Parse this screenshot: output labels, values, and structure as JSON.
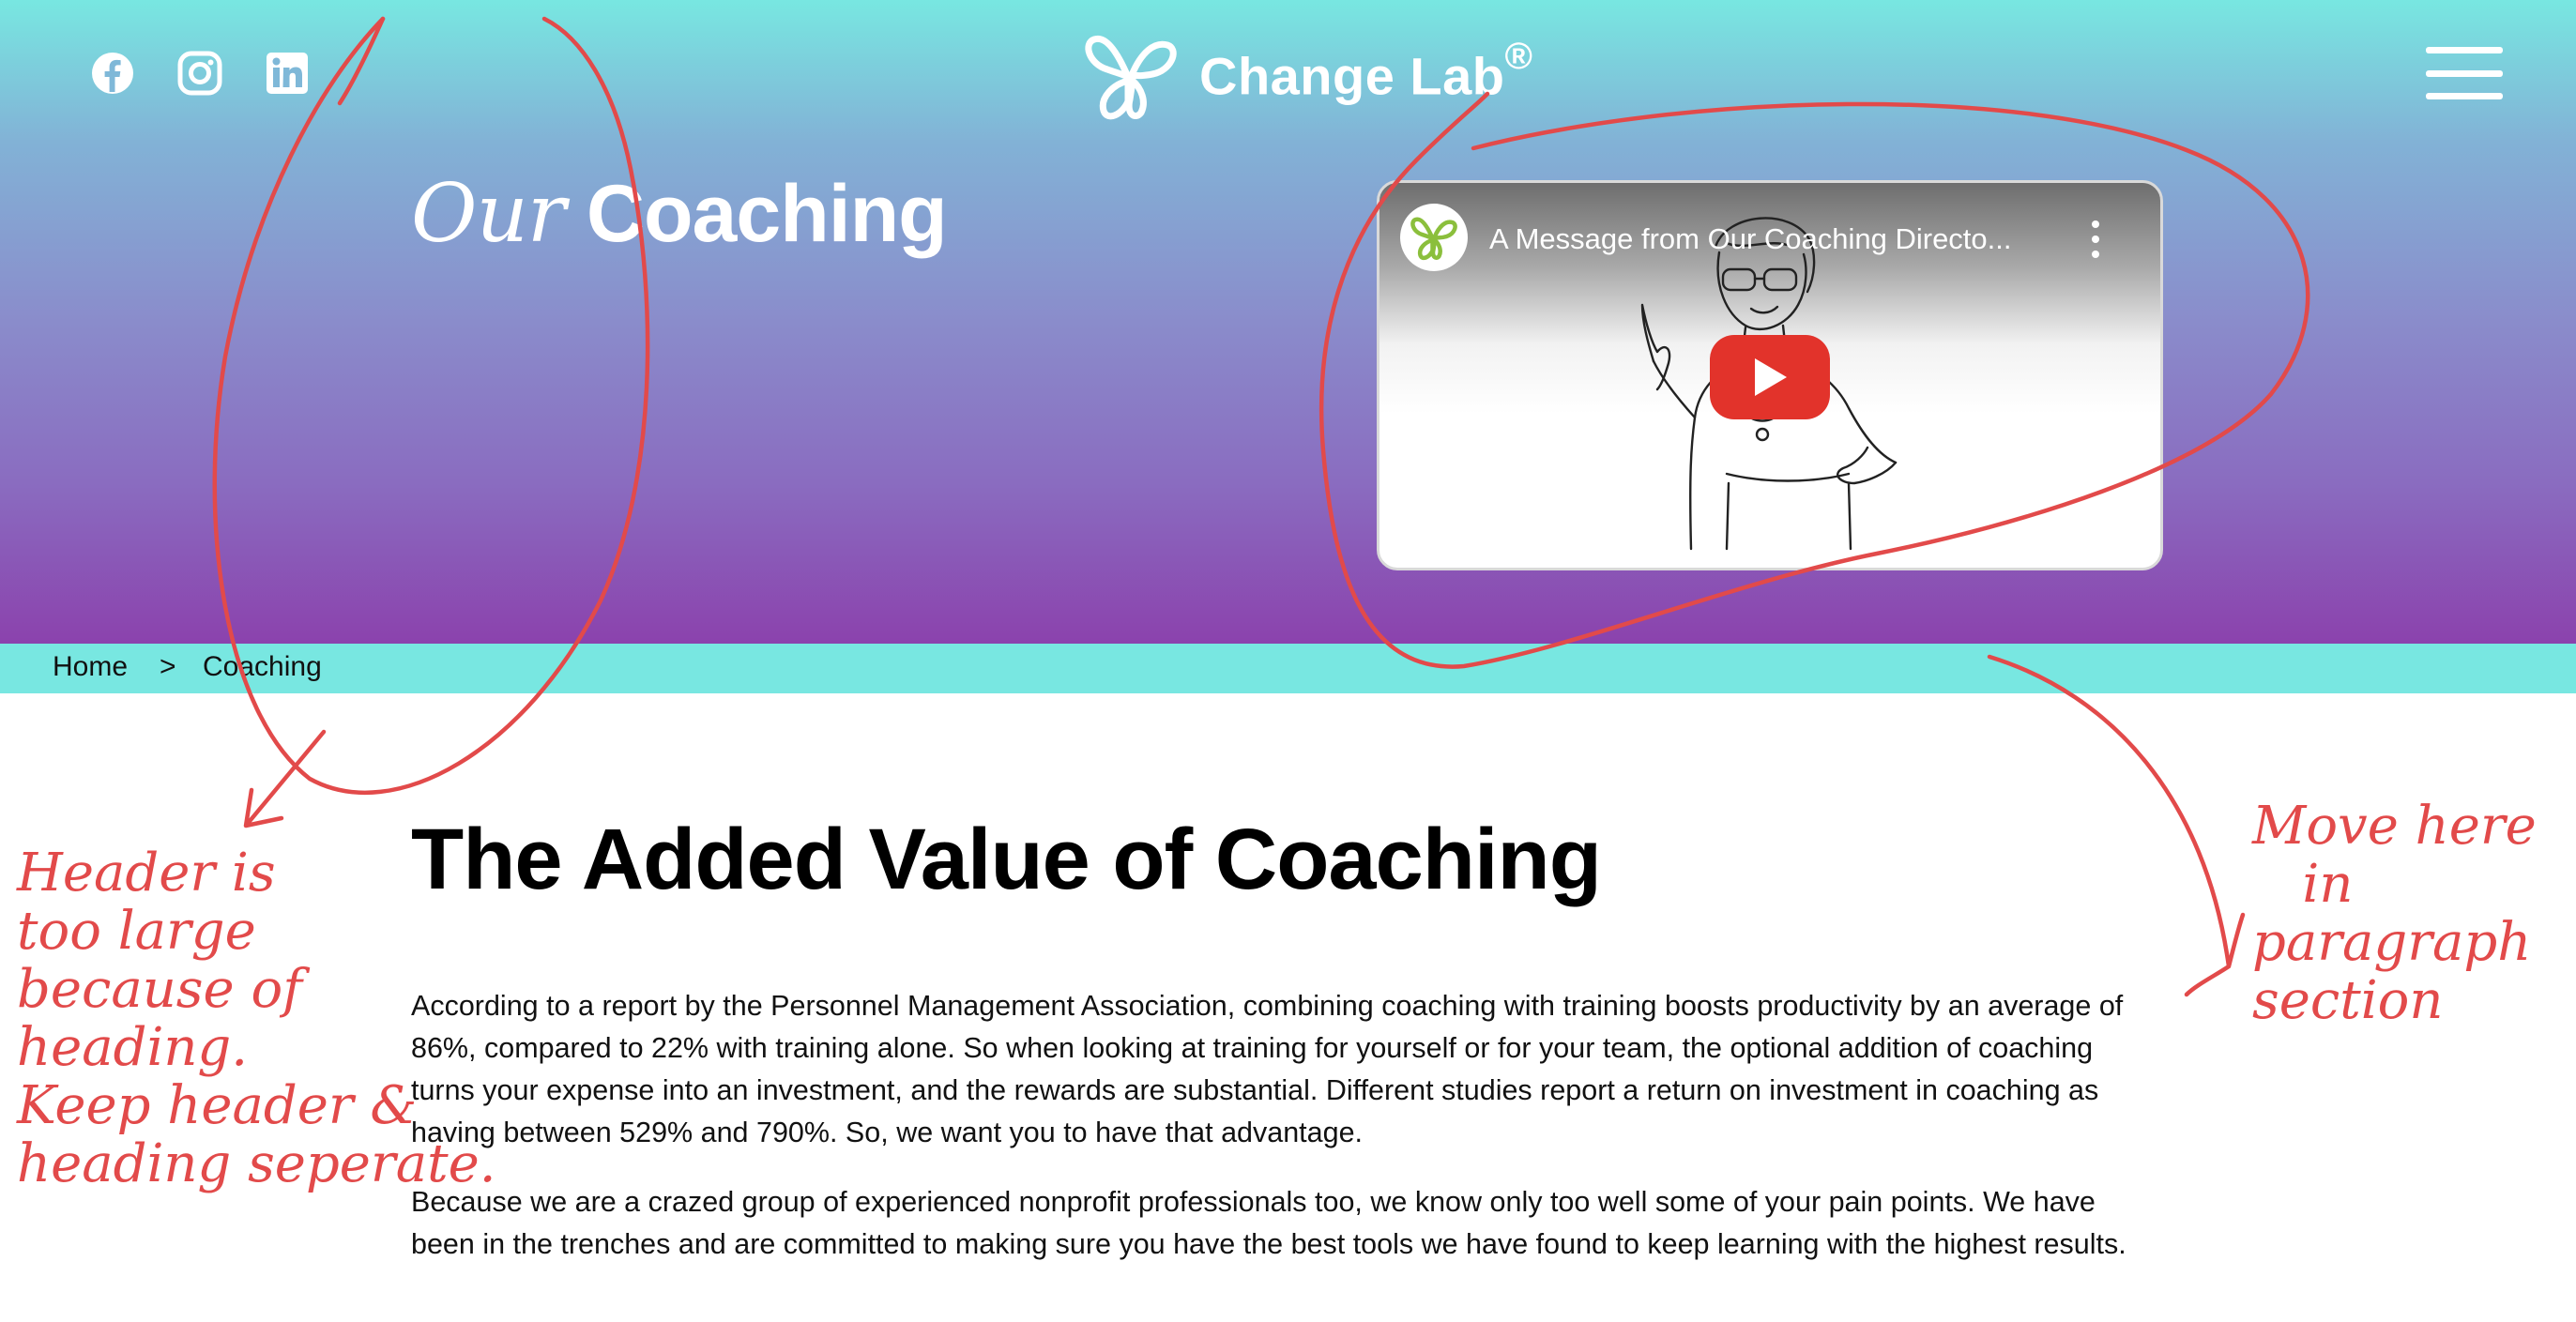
{
  "header": {
    "brand_name": "Change Lab",
    "brand_mark": "®",
    "social_icons": [
      "facebook-icon",
      "instagram-icon",
      "linkedin-icon"
    ],
    "menu_icon": "hamburger-menu-icon",
    "hero_title_script": "Our",
    "hero_title_main": "Coaching"
  },
  "video": {
    "title": "A Message from Our Coaching Directo...",
    "play_icon": "play-icon",
    "more_icon": "more-vertical-icon"
  },
  "breadcrumb": {
    "home": "Home",
    "separator": ">",
    "current": "Coaching"
  },
  "main": {
    "heading": "The Added Value of Coaching",
    "paragraphs": [
      "According to a report by the Personnel Management Association, combining coaching with training boosts productivity by an average of 86%, compared to 22% with training alone. So when looking at training for yourself or for your team, the optional addition of coaching turns your expense into an investment, and the rewards are substantial. Different studies report a return on investment in coaching as having between 529% and 790%. So, we want you to have that advantage.",
      "Because we are a crazed group of experienced nonprofit professionals too, we know only too well some of your pain points. We have been in the trenches and are committed to making sure you have the best tools we have found to keep learning with the highest results."
    ]
  },
  "annotations": {
    "left_note": "Header is\ntoo large\nbecause of\nheading.\nKeep header &\nheading seperate.",
    "right_note": "Move here\n   in\nparagraph\nsection"
  },
  "colors": {
    "gradient_top": "#78e7e1",
    "gradient_bottom": "#8b42ad",
    "breadcrumb_bar": "#78e7e1",
    "annotation_red": "#e24a4a",
    "play_red": "#e2332b"
  }
}
